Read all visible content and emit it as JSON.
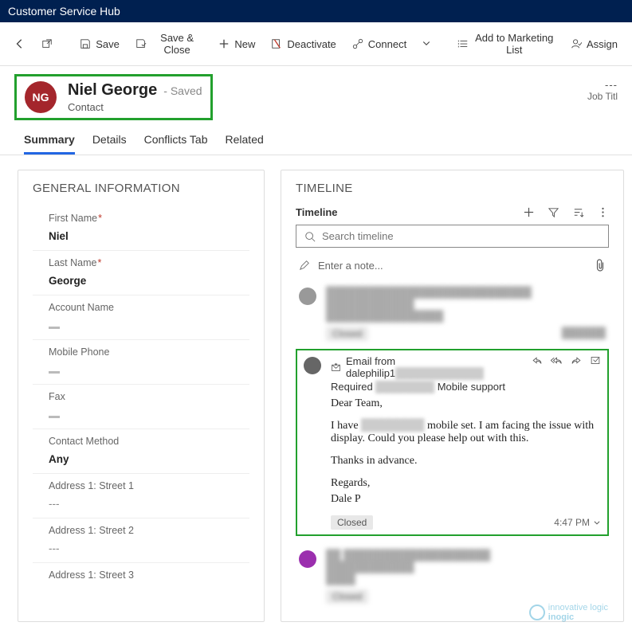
{
  "app": {
    "title": "Customer Service Hub"
  },
  "cmdbar": {
    "save": "Save",
    "save_close": "Save & Close",
    "new": "New",
    "deactivate": "Deactivate",
    "connect": "Connect",
    "marketing": "Add to Marketing List",
    "assign": "Assign"
  },
  "record": {
    "initials": "NG",
    "name": "Niel George",
    "saved": "- Saved",
    "type": "Contact",
    "job_title_val": "---",
    "job_title_lbl": "Job Titl"
  },
  "tabs": {
    "summary": "Summary",
    "details": "Details",
    "conflicts": "Conflicts Tab",
    "related": "Related"
  },
  "general": {
    "title": "GENERAL INFORMATION",
    "first_name_lbl": "First Name",
    "first_name_val": "Niel",
    "last_name_lbl": "Last Name",
    "last_name_val": "George",
    "account_lbl": "Account Name",
    "mobile_lbl": "Mobile Phone",
    "fax_lbl": "Fax",
    "contact_method_lbl": "Contact Method",
    "contact_method_val": "Any",
    "street1_lbl": "Address 1: Street 1",
    "street1_val": "---",
    "street2_lbl": "Address 1: Street 2",
    "street2_val": "---",
    "street3_lbl": "Address 1: Street 3"
  },
  "timeline": {
    "title": "TIMELINE",
    "header_lbl": "Timeline",
    "search_ph": "Search timeline",
    "note_ph": "Enter a note...",
    "email": {
      "prefix": "Email from dalephilip1",
      "subject_prefix": "Required",
      "subject_suffix": " Mobile support",
      "greeting": "Dear Team,",
      "body1a": "I have ",
      "body1b": " mobile set. I am facing the issue with display. Could you please help out with this.",
      "thanks": "Thanks in advance.",
      "regards": "Regards,",
      "sign": "Dale P",
      "status": "Closed",
      "time": "4:47 PM"
    }
  }
}
